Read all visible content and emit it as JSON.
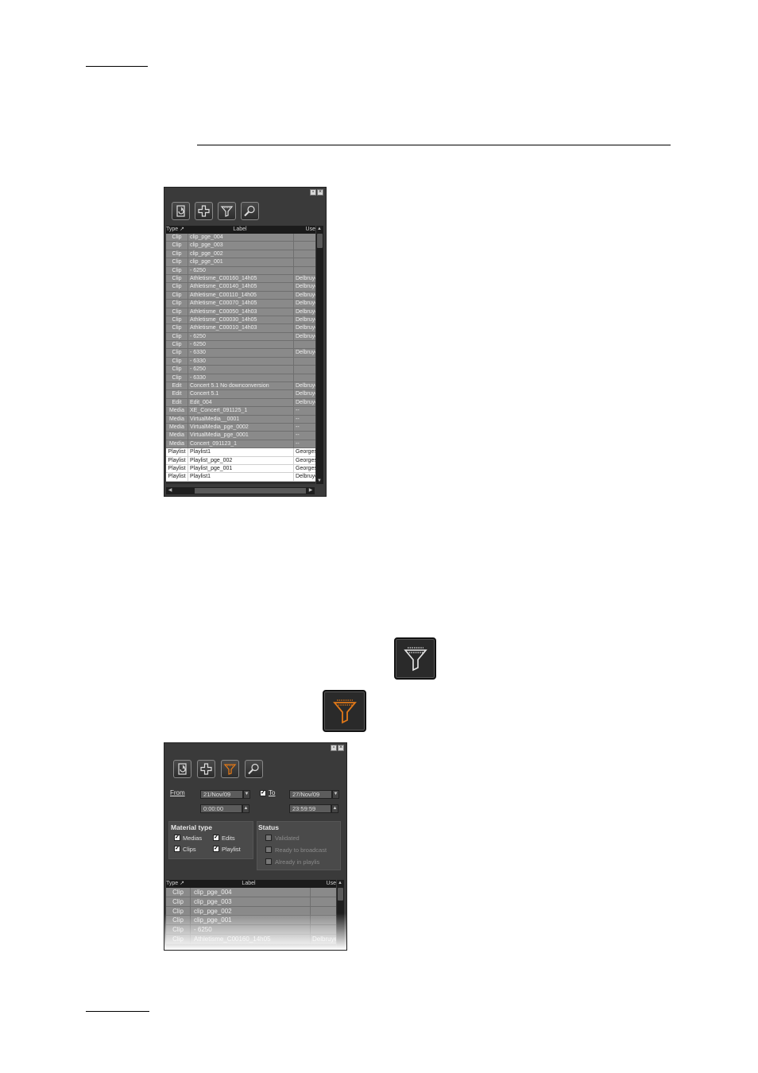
{
  "panel1": {
    "toolbar": [
      {
        "name": "refresh-icon"
      },
      {
        "name": "add-icon"
      },
      {
        "name": "filter-icon"
      },
      {
        "name": "search-icon"
      }
    ],
    "columns": {
      "type": "Type ↗",
      "label": "Label",
      "user": "Use"
    },
    "rows": [
      {
        "type": "Clip",
        "label": "clip_pge_004",
        "user": "",
        "state": "sel"
      },
      {
        "type": "Clip",
        "label": "clip_pge_003",
        "user": "",
        "state": "sel"
      },
      {
        "type": "Clip",
        "label": "clip_pge_002",
        "user": "",
        "state": "sel"
      },
      {
        "type": "Clip",
        "label": "clip_pge_001",
        "user": "",
        "state": "sel"
      },
      {
        "type": "Clip",
        "label": "- 6250",
        "user": "",
        "state": "sel"
      },
      {
        "type": "Clip",
        "label": "Athletisme_C00160_14h05",
        "user": "Delbruye",
        "state": "sel"
      },
      {
        "type": "Clip",
        "label": "Athletisme_C00140_14h05",
        "user": "Delbruye",
        "state": "sel"
      },
      {
        "type": "Clip",
        "label": "Athletisme_C00110_14h05",
        "user": "Delbruye",
        "state": "sel"
      },
      {
        "type": "Clip",
        "label": "Athletisme_C00070_14h05",
        "user": "Delbruye",
        "state": "sel"
      },
      {
        "type": "Clip",
        "label": "Athletisme_C00050_14h03",
        "user": "Delbruye",
        "state": "sel"
      },
      {
        "type": "Clip",
        "label": "Athletisme_C00030_14h05",
        "user": "Delbruye",
        "state": "sel"
      },
      {
        "type": "Clip",
        "label": "Athletisme_C00010_14h03",
        "user": "Delbruye",
        "state": "sel"
      },
      {
        "type": "Clip",
        "label": "- 6250",
        "user": "Delbruye",
        "state": "sel"
      },
      {
        "type": "Clip",
        "label": "- 6250",
        "user": "",
        "state": "sel"
      },
      {
        "type": "Clip",
        "label": "- 6330",
        "user": "Delbruye",
        "state": "sel"
      },
      {
        "type": "Clip",
        "label": "- 6330",
        "user": "",
        "state": "sel"
      },
      {
        "type": "Clip",
        "label": "- 6250",
        "user": "",
        "state": "sel"
      },
      {
        "type": "Clip",
        "label": "- 6330",
        "user": "",
        "state": "sel"
      },
      {
        "type": "Edit",
        "label": "Concert 5.1 No downconversion",
        "user": "Delbruye",
        "state": "sel"
      },
      {
        "type": "Edit",
        "label": "Concert 5.1",
        "user": "Delbruye",
        "state": "sel"
      },
      {
        "type": "Edit",
        "label": "Edit_004",
        "user": "Delbruye",
        "state": "sel"
      },
      {
        "type": "Media",
        "label": "XE_Concert_091125_1",
        "user": "--",
        "state": "sel"
      },
      {
        "type": "Media",
        "label": "VirtualMedia__0001",
        "user": "--",
        "state": "sel"
      },
      {
        "type": "Media",
        "label": "VirtualMedia_pge_0002",
        "user": "--",
        "state": "sel"
      },
      {
        "type": "Media",
        "label": "VirtualMedia_pge_0001",
        "user": "--",
        "state": "sel"
      },
      {
        "type": "Media",
        "label": "Concert_091123_1",
        "user": "--",
        "state": "sel"
      },
      {
        "type": "Playlist",
        "label": "Playlist1",
        "user": "Georges",
        "state": "norm"
      },
      {
        "type": "Playlist",
        "label": "Playlist_pge_002",
        "user": "Georges",
        "state": "norm"
      },
      {
        "type": "Playlist",
        "label": "Playlist_pge_001",
        "user": "Georges",
        "state": "norm"
      },
      {
        "type": "Playlist",
        "label": "Playlist1",
        "user": "Delbruye",
        "state": "norm"
      }
    ]
  },
  "icons": {
    "filter_off": "filter-icon",
    "filter_on": "filter-active-icon",
    "accent": "#e07818"
  },
  "panel2": {
    "from_label": "From",
    "from_date": "21/Nov/09",
    "from_time": "0:00:00",
    "to_label": "To",
    "to_date": "27/Nov/09",
    "to_time": "23:59:59",
    "material_type": {
      "title": "Material type",
      "options": [
        {
          "label": "Medias",
          "checked": true
        },
        {
          "label": "Edits",
          "checked": true
        },
        {
          "label": "Clips",
          "checked": true
        },
        {
          "label": "Playlist",
          "checked": true
        }
      ]
    },
    "status": {
      "title": "Status",
      "options": [
        {
          "label": "Validated",
          "checked": false
        },
        {
          "label": "Ready to broadcast",
          "checked": false
        },
        {
          "label": "Already in playlis",
          "checked": false
        }
      ]
    },
    "columns": {
      "type": "Type ↗",
      "label": "Label",
      "user": "Use"
    },
    "rows": [
      {
        "type": "Clip",
        "label": "clip_pge_004",
        "user": ""
      },
      {
        "type": "Clip",
        "label": "clip_pge_003",
        "user": ""
      },
      {
        "type": "Clip",
        "label": "clip_pge_002",
        "user": ""
      },
      {
        "type": "Clip",
        "label": "clip_pge_001",
        "user": ""
      },
      {
        "type": "Clip",
        "label": "- 6250",
        "user": ""
      },
      {
        "type": "Clip",
        "label": "Athletisme_C00160_14h05",
        "user": "Delbruye"
      }
    ]
  }
}
